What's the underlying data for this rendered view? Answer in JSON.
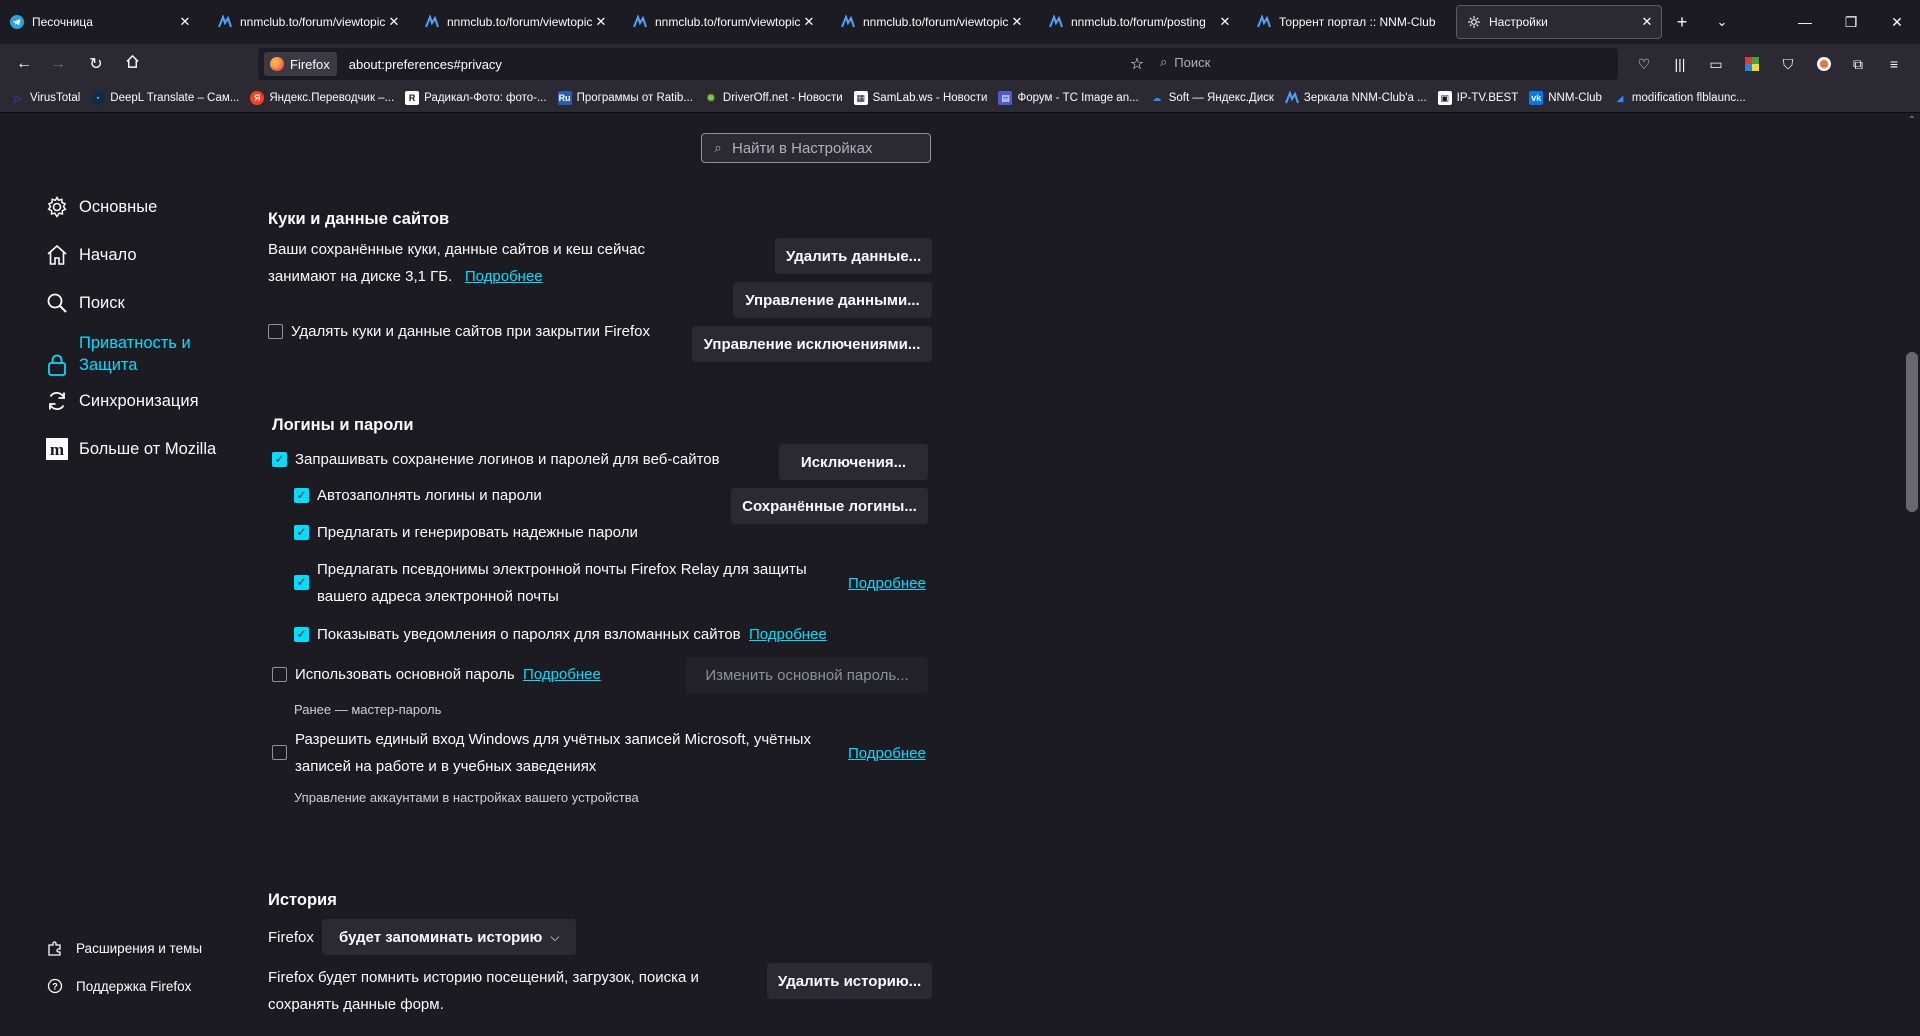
{
  "tabs": [
    {
      "title": "Песочница",
      "icon": "telegram-icon",
      "active": false
    },
    {
      "title": "nnmclub.to/forum/viewtopic",
      "icon": "nnm-icon",
      "active": false
    },
    {
      "title": "nnmclub.to/forum/viewtopic",
      "icon": "nnm-icon",
      "active": false
    },
    {
      "title": "nnmclub.to/forum/viewtopic",
      "icon": "nnm-icon",
      "active": false
    },
    {
      "title": "nnmclub.to/forum/viewtopic",
      "icon": "nnm-icon",
      "active": false
    },
    {
      "title": "nnmclub.to/forum/posting",
      "icon": "nnm-icon",
      "active": false
    },
    {
      "title": "Торрент портал :: NNM-Club",
      "icon": "nnm-icon",
      "active": false
    },
    {
      "title": "Настройки",
      "icon": "gear-icon",
      "active": true
    }
  ],
  "navbar": {
    "identity_label": "Firefox",
    "url": "about:preferences#privacy",
    "search_placeholder": "Поиск"
  },
  "bookmarks": [
    {
      "label": "VirusTotal",
      "icon": "virustotal-icon",
      "color": "#394eff"
    },
    {
      "label": "DeepL Translate – Сам...",
      "icon": "deepl-icon",
      "color": "#0f2b46"
    },
    {
      "label": "Яндекс.Переводчик –...",
      "icon": "yandex-icon",
      "color": "#fc3f1d"
    },
    {
      "label": "Радикал-Фото: фото-...",
      "icon": "radikal-icon",
      "color": "#ffffff"
    },
    {
      "label": "Программы от Ratib...",
      "icon": "ratib-icon",
      "color": "#2a5db0"
    },
    {
      "label": "DriverOff.net - Новости",
      "icon": "driveroff-icon",
      "color": "#7ac943"
    },
    {
      "label": "SamLab.ws - Новости",
      "icon": "samlab-icon",
      "color": "#ffffff"
    },
    {
      "label": "Форум - TC Image an...",
      "icon": "tc-icon",
      "color": "#4b5bd6"
    },
    {
      "label": "Soft — Яндекс.Диск",
      "icon": "yadisk-icon",
      "color": "#2d8cff"
    },
    {
      "label": "Зеркала NNM-Club'a ...",
      "icon": "nnm-icon",
      "color": "#2d8cff"
    },
    {
      "label": "IP-TV.BEST",
      "icon": "iptv-icon",
      "color": "#ffffff"
    },
    {
      "label": "NNM-Club",
      "icon": "vk-icon",
      "color": "#0077ff"
    },
    {
      "label": "modification flblaunc...",
      "icon": "mod-icon",
      "color": "#2d8cff"
    }
  ],
  "settings_search": {
    "placeholder": "Найти в Настройках"
  },
  "sidebar": {
    "items": [
      {
        "label": "Основные",
        "icon": "gear-icon"
      },
      {
        "label": "Начало",
        "icon": "home-icon"
      },
      {
        "label": "Поиск",
        "icon": "search-icon"
      },
      {
        "label": "Приватность и Защита",
        "icon": "lock-icon",
        "selected": true
      },
      {
        "label": "Синхронизация",
        "icon": "sync-icon"
      },
      {
        "label": "Больше от Mozilla",
        "icon": "mozilla-icon"
      }
    ],
    "footer": [
      {
        "label": "Расширения и темы",
        "icon": "puzzle-icon"
      },
      {
        "label": "Поддержка Firefox",
        "icon": "help-icon"
      }
    ]
  },
  "cookies": {
    "title": "Куки и данные сайтов",
    "desc_line1": "Ваши сохранённые куки, данные сайтов и кеш сейчас",
    "desc_line2": "занимают на диске 3,1 ГБ.",
    "learn_more": "Подробнее",
    "delete_on_close": "Удалять куки и данные сайтов при закрытии Firefox",
    "delete_on_close_checked": false,
    "btn_clear": "Удалить данные...",
    "btn_manage": "Управление данными...",
    "btn_exceptions": "Управление исключениями..."
  },
  "logins": {
    "title": "Логины и пароли",
    "ask_save": "Запрашивать сохранение логинов и паролей для веб-сайтов",
    "autofill": "Автозаполнять логины и пароли",
    "generate": "Предлагать и генерировать надежные пароли",
    "relay_line1": "Предлагать псевдонимы электронной почты Firefox Relay для защиты",
    "relay_line2": "вашего адреса электронной почты",
    "breach": "Показывать уведомления о паролях для взломанных сайтов",
    "primary_pw": "Использовать основной пароль",
    "primary_pw_note": "Ранее — мастер-пароль",
    "sso_line1": "Разрешить единый вход Windows для учётных записей Microsoft, учётных",
    "sso_line2": "записей на работе и в учебных заведениях",
    "sso_note": "Управление аккаунтами в настройках вашего устройства",
    "learn_more": "Подробнее",
    "btn_exceptions": "Исключения...",
    "btn_saved": "Сохранённые логины...",
    "btn_change_primary": "Изменить основной пароль..."
  },
  "history": {
    "title": "История",
    "firefox_label": "Firefox",
    "mode": "будет запоминать историю",
    "desc_line1": "Firefox будет помнить историю посещений, загрузок, поиска и",
    "desc_line2": "сохранять данные форм.",
    "btn_clear": "Удалить историю..."
  },
  "colors": {
    "accent": "#00ddff",
    "bg": "#1c1b22",
    "panel": "#2b2a33"
  }
}
